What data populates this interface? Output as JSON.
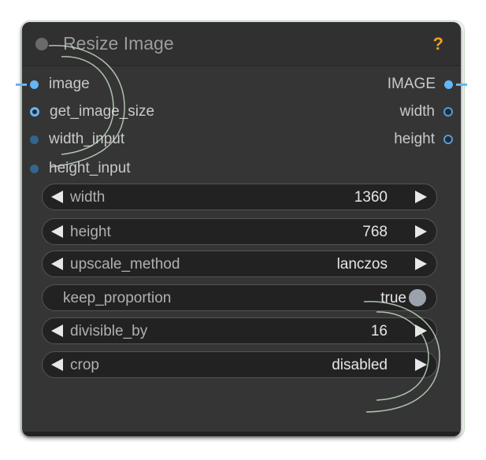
{
  "node": {
    "title": "Resize Image",
    "help_label": "?"
  },
  "inputs": [
    {
      "label": "image",
      "icon": "input-connected-dot"
    },
    {
      "label": "get_image_size",
      "icon": "input-ring-dot"
    },
    {
      "label": "width_input",
      "icon": "input-dot"
    },
    {
      "label": "height_input",
      "icon": "input-dot"
    }
  ],
  "outputs": [
    {
      "label": "IMAGE",
      "icon": "output-connected-dot"
    },
    {
      "label": "width",
      "icon": "output-dot"
    },
    {
      "label": "height",
      "icon": "output-dot"
    }
  ],
  "widgets": [
    {
      "label": "width",
      "value": "1360",
      "kind": "number"
    },
    {
      "label": "height",
      "value": "768",
      "kind": "number"
    },
    {
      "label": "upscale_method",
      "value": "lanczos",
      "kind": "combo"
    },
    {
      "label": "keep_proportion",
      "value": "true",
      "kind": "toggle"
    },
    {
      "label": "divisible_by",
      "value": "16",
      "kind": "number"
    },
    {
      "label": "crop",
      "value": "disabled",
      "kind": "combo"
    }
  ],
  "colors": {
    "node_bg": "#353535",
    "slot_blue": "#64b5f6",
    "help_orange": "#f0a020"
  }
}
